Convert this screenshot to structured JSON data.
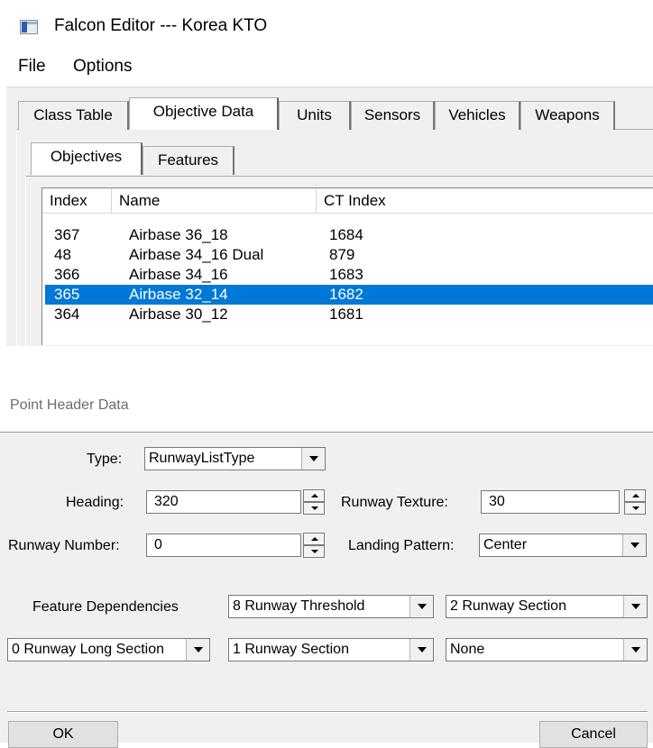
{
  "window": {
    "title": "Falcon Editor --- Korea KTO"
  },
  "menu": {
    "items": [
      "File",
      "Options"
    ]
  },
  "tabs": {
    "items": [
      "Class Table",
      "Objective Data",
      "Units",
      "Sensors",
      "Vehicles",
      "Weapons"
    ],
    "active": "Objective Data"
  },
  "subtabs": {
    "items": [
      "Objectives",
      "Features"
    ],
    "active": "Objectives"
  },
  "objectives_list": {
    "columns": [
      "Index",
      "Name",
      "CT Index"
    ],
    "rows": [
      {
        "index": "367",
        "name": "Airbase 36_18",
        "ct_index": "1684"
      },
      {
        "index": "48",
        "name": "Airbase 34_16 Dual",
        "ct_index": "879"
      },
      {
        "index": "366",
        "name": "Airbase 34_16",
        "ct_index": "1683"
      },
      {
        "index": "365",
        "name": "Airbase 32_14",
        "ct_index": "1682"
      },
      {
        "index": "364",
        "name": "Airbase 30_12",
        "ct_index": "1681"
      }
    ],
    "selected_index": "365"
  },
  "dialog": {
    "title": "Point Header Data",
    "type_label": "Type:",
    "type_value": "RunwayListType",
    "heading_label": "Heading:",
    "heading_value": "320",
    "runway_texture_label": "Runway Texture:",
    "runway_texture_value": "30",
    "runway_number_label": "Runway Number:",
    "runway_number_value": "0",
    "landing_pattern_label": "Landing Pattern:",
    "landing_pattern_value": "Center",
    "feature_dependencies_label": "Feature Dependencies",
    "dependencies": [
      "8 Runway Threshold",
      "2 Runway Section",
      "0 Runway Long Section",
      "1 Runway Section",
      "None"
    ],
    "ok_label": "OK",
    "cancel_label": "Cancel"
  },
  "colors": {
    "selection": "#0078d7",
    "window_bg": "#f0f0f0"
  }
}
